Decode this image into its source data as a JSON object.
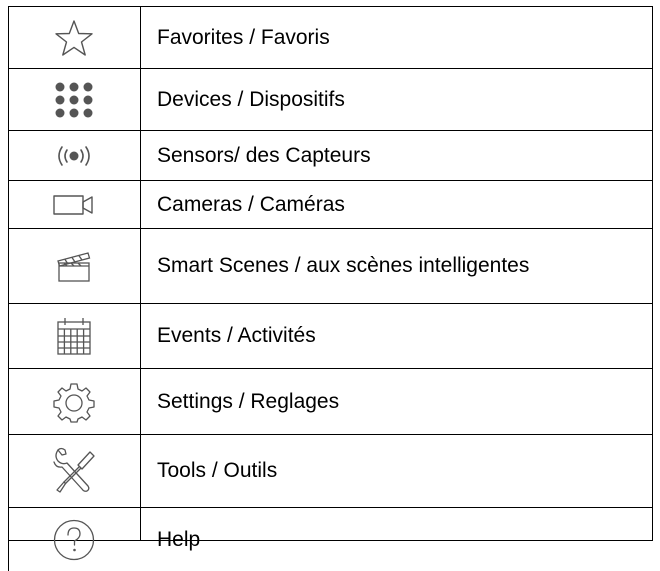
{
  "menu": {
    "items": [
      {
        "icon": "star-icon",
        "label": "Favorites / Favoris"
      },
      {
        "icon": "grid-dots-icon",
        "label": "Devices / Dispositifs"
      },
      {
        "icon": "sensor-signal-icon",
        "label": "Sensors/ des Capteurs"
      },
      {
        "icon": "video-camera-icon",
        "label": "Cameras / Caméras"
      },
      {
        "icon": "clapperboard-icon",
        "label": "Smart Scenes / aux scènes intelligentes"
      },
      {
        "icon": "calendar-icon",
        "label": "Events / Activités"
      },
      {
        "icon": "gear-icon",
        "label": "Settings / Reglages"
      },
      {
        "icon": "tools-icon",
        "label": "Tools / Outils"
      },
      {
        "icon": "help-icon",
        "label": "Help"
      }
    ]
  },
  "colors": {
    "icon_stroke": "#555555",
    "border": "#000000",
    "text": "#000000"
  }
}
